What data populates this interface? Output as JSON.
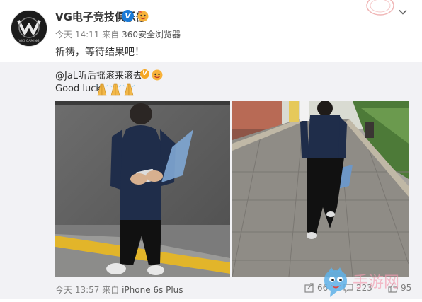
{
  "post": {
    "author": "VG电子竞技俱乐部",
    "verified_badge": "V",
    "time": "今天 14:11",
    "from_word": "来自",
    "source": "360安全浏览器",
    "content": "祈祷，等待结果吧！",
    "avatar_text": "VICI GAMING"
  },
  "repost": {
    "user": "@JaL听后摇滚来滚去",
    "verified_badge": "V",
    "text": "Good luck",
    "emoji": "praying-hands-icon x3",
    "time": "今天 13:57",
    "from_word": "来自",
    "device": "iPhone 6s Plus",
    "counts": {
      "forward": "66",
      "comment": "223",
      "like": "95"
    }
  },
  "watermark": {
    "text": "手游网"
  },
  "colors": {
    "link": "#eb7350",
    "meta": "#808080",
    "repost_bg": "#f2f2f5",
    "verified_blue": "#1a7ad6",
    "verified_gold": "#f5a623"
  }
}
